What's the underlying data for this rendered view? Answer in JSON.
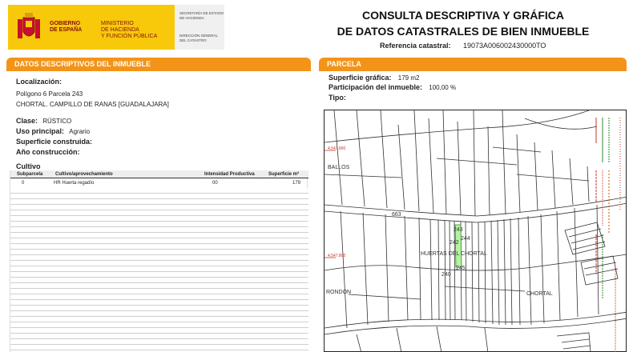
{
  "header": {
    "gov": [
      "GOBIERNO",
      "DE ESPAÑA"
    ],
    "ministry": [
      "MINISTERIO",
      "DE HACIENDA",
      "Y FUNCIÓN PÚBLICA"
    ],
    "secretaria": [
      "SECRETARÍA DE ESTADO",
      "DE HACIENDA"
    ],
    "direccion": [
      "DIRECCIÓN GENERAL",
      "DEL CATASTRO"
    ],
    "title_line1": "CONSULTA DESCRIPTIVA Y GRÁFICA",
    "title_line2": "DE DATOS CATASTRALES DE BIEN INMUEBLE",
    "ref_label": "Referencia catastral:",
    "ref_value": "19073A006002430000TO"
  },
  "left": {
    "section_title": "DATOS DESCRIPTIVOS DEL INMUEBLE",
    "localizacion_label": "Localización:",
    "localizacion_line1": "Polígono 6 Parcela 243",
    "localizacion_line2": "CHORTAL. CAMPILLO DE RANAS [GUADALAJARA]",
    "clase_label": "Clase:",
    "clase_value": "RÚSTICO",
    "uso_label": "Uso principal:",
    "uso_value": "Agrario",
    "sup_label": "Superficie construida:",
    "anio_label": "Año construcción:",
    "cultivo_title": "Cultivo",
    "table": {
      "headers": [
        "Subparcela",
        "Cultivo/aprovechamiento",
        "Intensidad Productiva",
        "Superficie m²"
      ],
      "rows": [
        [
          "0",
          "HR Huerta regadío",
          "00",
          "179"
        ]
      ]
    }
  },
  "right": {
    "section_title": "PARCELA",
    "sup_grafica_label": "Superficie gráfica:",
    "sup_grafica_value": "179 m2",
    "participacion_label": "Participación del inmueble:",
    "participacion_value": "100,00 %",
    "tipo_label": "Tipo:",
    "map": {
      "labels": {
        "ballos": "BALLOS",
        "huertas": "HUERTAS DEL CHORTAL",
        "chortal": "CHORTAL",
        "rondon": "RONDON",
        "p663": "663",
        "p244": "244",
        "p245": "245",
        "p240": "240",
        "p243": "243",
        "p242": "242"
      },
      "coord_top": "4.547.900",
      "coord_mid": "4.547.800"
    }
  },
  "colors": {
    "orange": "#f39419",
    "yellow": "#f7c90a",
    "red": "#c0392b"
  }
}
